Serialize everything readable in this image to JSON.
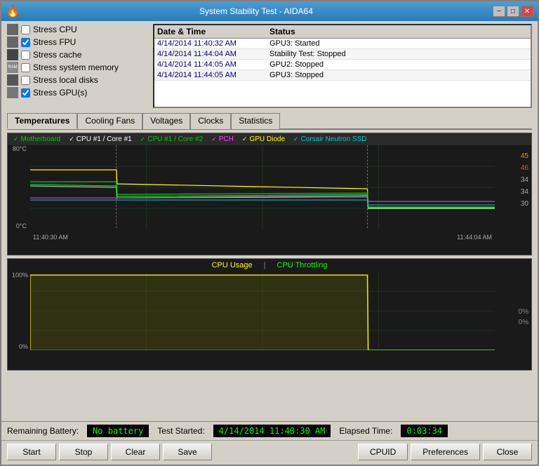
{
  "window": {
    "title": "System Stability Test - AIDA64"
  },
  "controls": {
    "stress_cpu": {
      "label": "Stress CPU",
      "checked": false
    },
    "stress_fpu": {
      "label": "Stress FPU",
      "checked": true
    },
    "stress_cache": {
      "label": "Stress cache",
      "checked": false
    },
    "stress_memory": {
      "label": "Stress system memory",
      "checked": false
    },
    "stress_disks": {
      "label": "Stress local disks",
      "checked": false
    },
    "stress_gpu": {
      "label": "Stress GPU(s)",
      "checked": true
    }
  },
  "log": {
    "headers": [
      "Date & Time",
      "Status"
    ],
    "rows": [
      {
        "time": "4/14/2014 11:40:32 AM",
        "status": "GPU3: Started"
      },
      {
        "time": "4/14/2014 11:44:04 AM",
        "status": "Stability Test: Stopped"
      },
      {
        "time": "4/14/2014 11:44:05 AM",
        "status": "GPU2: Stopped"
      },
      {
        "time": "4/14/2014 11:44:05 AM",
        "status": "GPU3: Stopped"
      }
    ]
  },
  "tabs": [
    "Temperatures",
    "Cooling Fans",
    "Voltages",
    "Clocks",
    "Statistics"
  ],
  "active_tab": "Temperatures",
  "temp_chart": {
    "legend": [
      {
        "label": "Motherboard",
        "color": "#00cc00"
      },
      {
        "label": "CPU #1 / Core #1",
        "color": "#ffffff"
      },
      {
        "label": "CPU #1 / Core #2",
        "color": "#00cc00"
      },
      {
        "label": "PCH",
        "color": "#ff00ff"
      },
      {
        "label": "GPU Diode",
        "color": "#ffff00"
      },
      {
        "label": "Corsair Neutron SSD",
        "color": "#00cccc"
      }
    ],
    "y_max": "80°C",
    "y_min": "0°C",
    "x_start": "11:40:30 AM",
    "x_end": "11:44:04 AM",
    "right_values": [
      {
        "val": "45",
        "color": "#ff8800"
      },
      {
        "val": "46",
        "color": "#ff4444"
      },
      {
        "val": "34",
        "color": "#888888"
      },
      {
        "val": "34",
        "color": "#888888"
      },
      {
        "val": "30",
        "color": "#888888"
      }
    ]
  },
  "cpu_chart": {
    "legend_items": [
      {
        "label": "CPU Usage",
        "color": "#ffff00"
      },
      {
        "label": "CPU Throttling",
        "color": "#00ff00"
      }
    ],
    "y_max": "100%",
    "y_min": "0%",
    "right_values": [
      {
        "val": "0%",
        "color": "#888888"
      },
      {
        "val": "0%",
        "color": "#888888"
      }
    ]
  },
  "status": {
    "battery_label": "Remaining Battery:",
    "battery_value": "No battery",
    "test_started_label": "Test Started:",
    "test_started_value": "4/14/2014 11:40:30 AM",
    "elapsed_label": "Elapsed Time:",
    "elapsed_value": "0:03:34"
  },
  "buttons": {
    "start": "Start",
    "stop": "Stop",
    "clear": "Clear",
    "save": "Save",
    "cpuid": "CPUID",
    "preferences": "Preferences",
    "close": "Close"
  },
  "title_buttons": {
    "minimize": "−",
    "maximize": "□",
    "close": "✕"
  }
}
